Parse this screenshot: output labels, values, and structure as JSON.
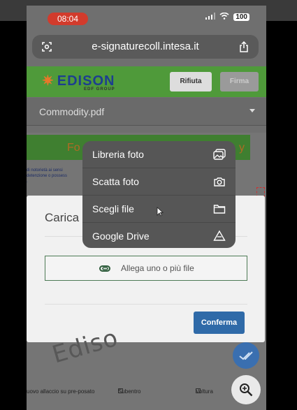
{
  "status_bar": {
    "time": "08:04",
    "battery": "100"
  },
  "browser": {
    "url": "e-signaturecoll.intesa.it",
    "left_icon": "reader-icon",
    "right_icon": "share-icon"
  },
  "header": {
    "logo_text": "EDISON",
    "logo_subtext": "EDF GROUP",
    "reject_label": "Rifiuta",
    "sign_label": "Firma"
  },
  "document_select": {
    "selected": "Commodity.pdf"
  },
  "document": {
    "banner_left": "Fo",
    "banner_right": "y",
    "lines": [
      "di notorietà ai sensi",
      "detenzione o possess",
      "."
    ],
    "watermark": "Ediso",
    "options": [
      "uovo allaccio su pre-posato",
      "Subentro",
      "Voltura"
    ]
  },
  "dialog": {
    "title": "Carica a",
    "attach_label": "Allega uno o più file",
    "confirm_label": "Conferma"
  },
  "menu": {
    "items": [
      {
        "label": "Libreria foto",
        "icon": "photo-library-icon"
      },
      {
        "label": "Scatta foto",
        "icon": "camera-icon"
      },
      {
        "label": "Scegli file",
        "icon": "folder-icon"
      },
      {
        "label": "Google Drive",
        "icon": "google-drive-icon"
      }
    ]
  },
  "colors": {
    "edison_green": "#4f9a3a",
    "confirm_blue": "#2f6aa8",
    "menu_bg": "#565656",
    "time_pill": "#d23b2c"
  }
}
